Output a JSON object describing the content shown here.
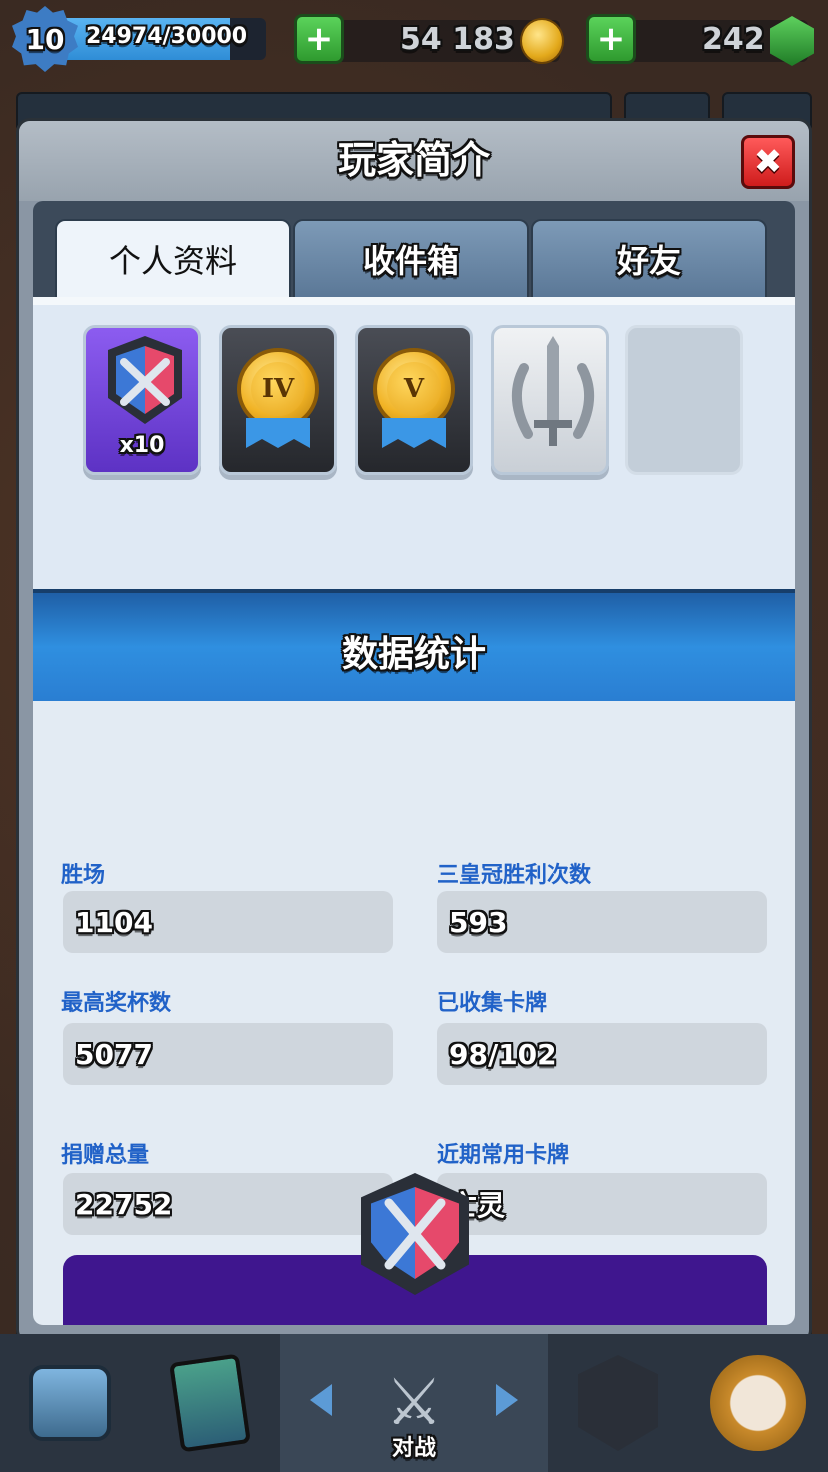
{
  "hud": {
    "level": "10",
    "xp_text": "24974/30000",
    "xp_progress": 0.8325,
    "gold": "54 183",
    "gems": "242",
    "plus_symbol": "+"
  },
  "modal": {
    "title": "玩家简介",
    "close_symbol": "✖",
    "tabs": [
      {
        "label": "个人资料",
        "active": true
      },
      {
        "label": "收件箱",
        "active": false
      },
      {
        "label": "好友",
        "active": false
      }
    ]
  },
  "badges": [
    {
      "icon": "clan-wars-badge-icon",
      "count": "x10",
      "style": "purple"
    },
    {
      "icon": "gold-medal-icon",
      "numeral": "IV",
      "style": "dark"
    },
    {
      "icon": "gold-medal-icon",
      "numeral": "V",
      "style": "dark"
    },
    {
      "icon": "silver-sword-laurel-icon",
      "style": "silver"
    },
    {
      "icon": "empty-slot",
      "style": "empty"
    }
  ],
  "stats": {
    "title": "数据统计",
    "items": [
      {
        "label": "胜场",
        "value": "1104"
      },
      {
        "label": "三皇冠胜利次数",
        "value": "593"
      },
      {
        "label": "最高奖杯数",
        "value": "5077"
      },
      {
        "label": "已收集卡牌",
        "value": "98/102"
      },
      {
        "label": "捐赠总量",
        "value": "22752"
      },
      {
        "label": "近期常用卡牌",
        "value": "亡灵"
      }
    ]
  },
  "nav": {
    "battle_label": "对战"
  },
  "colors": {
    "stat_label": "#2162c8",
    "banner_blue": "#2f8fe0",
    "close_red": "#cf1c1c",
    "plus_green": "#2f9a2f",
    "purple_panel": "#3f168e"
  }
}
